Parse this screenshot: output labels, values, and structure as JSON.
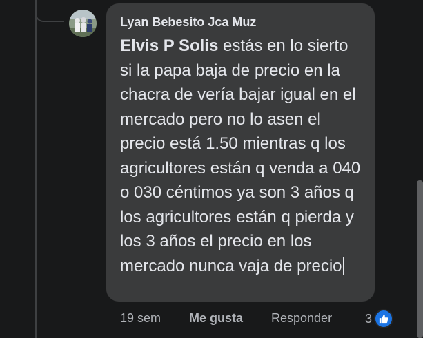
{
  "comment": {
    "author": "Lyan Bebesito Jca Muz",
    "mention": "Elvis P Solis",
    "text": " estás en lo sierto si la papa baja de precio en la chacra de vería bajar igual en el mercado pero no lo asen el precio está 1.50 mientras q los agricultores están q venda a 040 o 030 céntimos ya son 3 años q los agricultores están q pierda y los 3 años el precio en los mercado nunca vaja de precio",
    "avatar_icon": "profile-photo"
  },
  "actions": {
    "time": "19 sem",
    "like_label": "Me gusta",
    "reply_label": "Responder"
  },
  "reactions": {
    "count": "3",
    "icon": "thumbs-up-icon",
    "color": "#1b74e4"
  },
  "colors": {
    "background": "#18191a",
    "bubble": "#3a3b3c",
    "text": "#e4e6eb",
    "secondary_text": "#b0b3b8"
  }
}
